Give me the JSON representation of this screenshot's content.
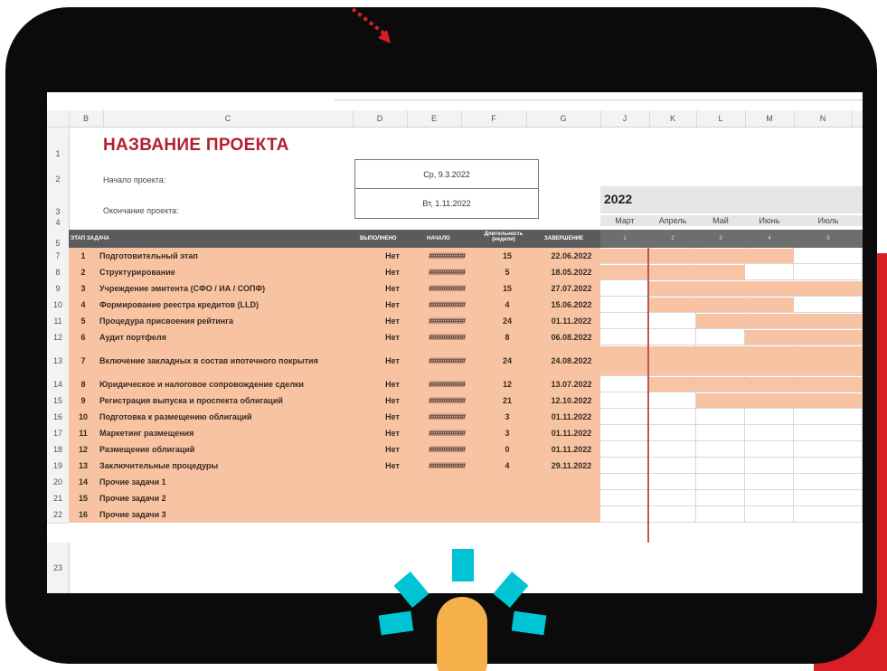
{
  "sheet": {
    "columns": [
      "B",
      "C",
      "D",
      "E",
      "F",
      "G",
      "J",
      "K",
      "L",
      "M",
      "N"
    ],
    "rows": [
      "1",
      "2",
      "3",
      "4",
      "5",
      "7",
      "8",
      "9",
      "10",
      "11",
      "12",
      "13",
      "14",
      "15",
      "16",
      "17",
      "18",
      "19",
      "20",
      "21",
      "22",
      "23"
    ],
    "title": "НАЗВАНИЕ ПРОЕКТА",
    "start_label": "Начало проекта:",
    "start_value": "Ср, 9.3.2022",
    "end_label": "Окончание проекта:",
    "end_value": "Вт, 1.11.2022",
    "year": "2022",
    "months": [
      "Март",
      "Апрель",
      "Май",
      "Июнь",
      "Июль"
    ],
    "week_numbers": [
      "1",
      "2",
      "3",
      "4",
      "5"
    ],
    "headers": {
      "stage": "ЭТАП",
      "task": "ЗАДАЧА",
      "done": "ВЫПОЛНЕНО",
      "start": "НАЧАЛО",
      "duration": "Длительность (недели)",
      "end": "ЗАВЕРШЕНИЕ"
    },
    "tasks": [
      {
        "num": "1",
        "name": "Подготовительный этап",
        "done": "Нет",
        "start": "##########",
        "dur": "15",
        "end": "22.06.2022",
        "bar": [
          0,
          4
        ]
      },
      {
        "num": "2",
        "name": "Структурирование",
        "done": "Нет",
        "start": "##########",
        "dur": "5",
        "end": "18.05.2022",
        "bar": [
          0,
          3
        ]
      },
      {
        "num": "3",
        "name": "Учреждение эмитента (СФО / ИА / СОПФ)",
        "done": "Нет",
        "start": "##########",
        "dur": "15",
        "end": "27.07.2022",
        "bar": [
          1,
          5
        ]
      },
      {
        "num": "4",
        "name": "Формирование реестра кредитов (LLD)",
        "done": "Нет",
        "start": "##########",
        "dur": "4",
        "end": "15.06.2022",
        "bar": [
          1,
          4
        ]
      },
      {
        "num": "5",
        "name": "Процедура присвоения рейтинга",
        "done": "Нет",
        "start": "##########",
        "dur": "24",
        "end": "01.11.2022",
        "bar": [
          2,
          5
        ]
      },
      {
        "num": "6",
        "name": "Аудит портфеля",
        "done": "Нет",
        "start": "##########",
        "dur": "8",
        "end": "06.08.2022",
        "bar": [
          3,
          5
        ]
      },
      {
        "num": "7",
        "name": "Включение закладных в состав ипотечного покрытия",
        "done": "Нет",
        "start": "##########",
        "dur": "24",
        "end": "24.08.2022",
        "bar": [
          0,
          5
        ]
      },
      {
        "num": "8",
        "name": "Юридическое и налоговое сопровождение сделки",
        "done": "Нет",
        "start": "##########",
        "dur": "12",
        "end": "13.07.2022",
        "bar": [
          1,
          5
        ]
      },
      {
        "num": "9",
        "name": "Регистрация выпуска и проспекта облигаций",
        "done": "Нет",
        "start": "##########",
        "dur": "21",
        "end": "12.10.2022",
        "bar": [
          2,
          5
        ]
      },
      {
        "num": "10",
        "name": "Подготовка к размещению облигаций",
        "done": "Нет",
        "start": "##########",
        "dur": "3",
        "end": "01.11.2022",
        "bar": null
      },
      {
        "num": "11",
        "name": "Маркетинг размещения",
        "done": "Нет",
        "start": "##########",
        "dur": "3",
        "end": "01.11.2022",
        "bar": null
      },
      {
        "num": "12",
        "name": "Размещение облигаций",
        "done": "Нет",
        "start": "##########",
        "dur": "0",
        "end": "01.11.2022",
        "bar": null
      },
      {
        "num": "13",
        "name": "Заключительные процедуры",
        "done": "Нет",
        "start": "##########",
        "dur": "4",
        "end": "29.11.2022",
        "bar": null
      },
      {
        "num": "14",
        "name": "Прочие задачи 1",
        "done": "",
        "start": "",
        "dur": "",
        "end": "",
        "bar": null
      },
      {
        "num": "15",
        "name": "Прочие задачи 2",
        "done": "",
        "start": "",
        "dur": "",
        "end": "",
        "bar": null
      },
      {
        "num": "16",
        "name": "Прочие задачи 3",
        "done": "",
        "start": "",
        "dur": "",
        "end": "",
        "bar": null
      }
    ]
  },
  "colors": {
    "frame": "#0b0b0b",
    "accent_red": "#d81f26",
    "title": "#b3202a",
    "task_fill": "#f7c3a3",
    "header_dark": "#5b5b5b",
    "burst_cyan": "#00c4d4",
    "finger": "#f5b04c"
  }
}
